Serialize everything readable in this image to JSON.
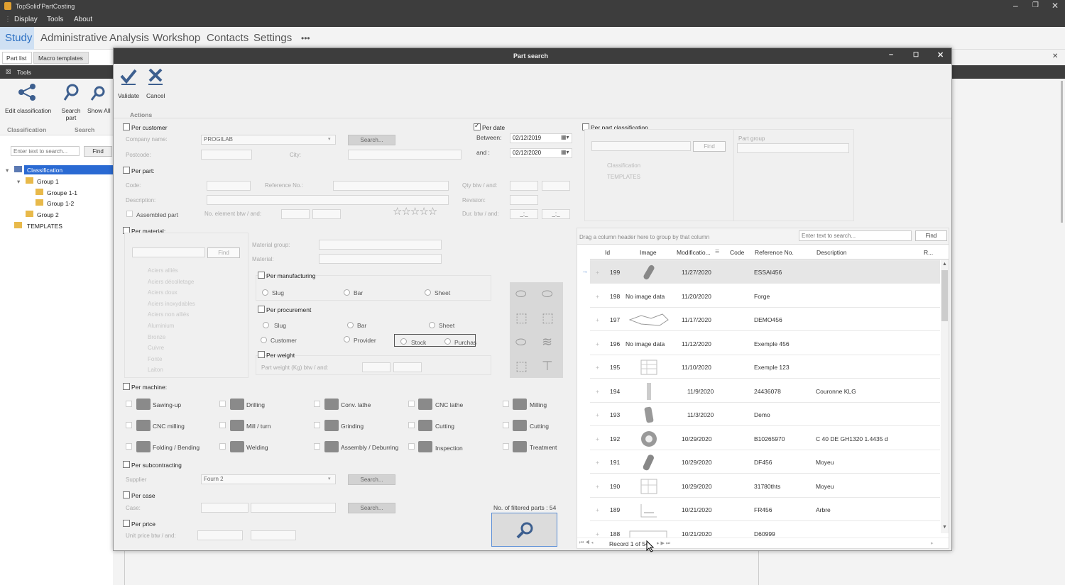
{
  "app": {
    "title": "TopSolid'PartCosting",
    "menu": [
      "Display",
      "Tools",
      "About"
    ]
  },
  "ribbon_tabs": [
    "Study",
    "Administrative",
    "Analysis",
    "Workshop",
    "Contacts",
    "Settings",
    "•••"
  ],
  "doc_tabs": [
    "Part list",
    "Macro templates"
  ],
  "tools_menu": "Tools",
  "left_ribbon": {
    "edit_classification": "Edit classification",
    "search_part": "Search part",
    "show_all": "Show All",
    "group_classification": "Classification",
    "group_search": "Search"
  },
  "left_search": {
    "placeholder": "Enter text to search...",
    "find": "Find"
  },
  "left_tree": [
    "Classification",
    "Group 1",
    "Groupe 1-1",
    "Group 1-2",
    "Group 2",
    "TEMPLATES"
  ],
  "dialog": {
    "title": "Part search",
    "validate": "Validate",
    "cancel": "Cancel",
    "actions": "Actions",
    "per_customer": "Per customer",
    "company_name": "Company name:",
    "company_value": "PROGILAB",
    "search_btn": "Search...",
    "postcode": "Postcode:",
    "city": "City:",
    "per_date": "Per date",
    "between": "Between:",
    "and": "and :",
    "date1": "02/12/2019",
    "date2": "02/12/2020",
    "per_part_classification": "Per part classification",
    "part_group": "Part group",
    "class_find": "Find",
    "class_tree": [
      "Classification",
      "TEMPLATES"
    ],
    "per_part": "Per part:",
    "code": "Code:",
    "reference": "Reference No.:",
    "qty": "Qty btw / and:",
    "description": "Description:",
    "revision": "Revision:",
    "assembled": "Assembled part",
    "no_element": "No. element btw / and:",
    "dur": "Dur. btw / and:",
    "dur1": "_:_",
    "dur2": "_:_",
    "per_material": "Per material:",
    "mat_find": "Find",
    "material_group": "Material group:",
    "material": "Material:",
    "material_list": [
      "Aciers alliés",
      "Aciers décolletage",
      "Aciers doux",
      "Aciers inoxydables",
      "Aciers non alliés",
      "Aluminium",
      "Bronze",
      "Cuivre",
      "Fonte",
      "Laiton"
    ],
    "per_manufacturing": "Per manufacturing",
    "manuf_opts": [
      "Slug",
      "Bar",
      "Sheet"
    ],
    "per_procurement": "Per procurement",
    "proc_opts": [
      "Slug",
      "Bar",
      "Sheet"
    ],
    "proc_opts2": [
      "Customer",
      "Provider"
    ],
    "stock": "Stock",
    "purchase": "Purchas",
    "per_weight": "Per weight",
    "part_weight": "Part weight (Kg) btw / and:",
    "per_machine": "Per machine:",
    "machines": [
      "Sawing-up",
      "Drilling",
      "Conv. lathe",
      "CNC lathe",
      "Milling",
      "CNC milling",
      "Mill / turn",
      "Grinding",
      "Cutting",
      "Cutting",
      "Folding / Bending",
      "Welding",
      "Assembly / Deburring",
      "Inspection",
      "Treatment"
    ],
    "per_subcontracting": "Per subcontracting",
    "supplier": "Supplier",
    "supplier_value": "Fourn 2",
    "per_case": "Per case",
    "case": "Case:",
    "per_price": "Per price",
    "unit_price": "Unit price btw / and:",
    "filtered": "No. of filtered parts : 54"
  },
  "grid": {
    "drag_hint": "Drag a column header here to group by that column",
    "search_placeholder": "Enter text to search...",
    "find": "Find",
    "columns": [
      "Id",
      "Image",
      "Modificatio...",
      "Code",
      "Reference No.",
      "Description",
      "R..."
    ],
    "rows": [
      {
        "id": "199",
        "image": "",
        "date": "11/27/2020",
        "ref": "ESSAI456",
        "desc": ""
      },
      {
        "id": "198",
        "image": "No image data",
        "date": "11/20/2020",
        "ref": "Forge",
        "desc": ""
      },
      {
        "id": "197",
        "image": "",
        "date": "11/17/2020",
        "ref": "DEMO456",
        "desc": ""
      },
      {
        "id": "196",
        "image": "No image data",
        "date": "11/12/2020",
        "ref": "Exemple 456",
        "desc": ""
      },
      {
        "id": "195",
        "image": "",
        "date": "11/10/2020",
        "ref": "Exemple 123",
        "desc": ""
      },
      {
        "id": "194",
        "image": "",
        "date": "11/9/2020",
        "ref": "24436078",
        "desc": "Couronne KLG"
      },
      {
        "id": "193",
        "image": "",
        "date": "11/3/2020",
        "ref": "Demo",
        "desc": ""
      },
      {
        "id": "192",
        "image": "",
        "date": "10/29/2020",
        "ref": "B10265970",
        "desc": "C 40 DE GH1320 1.4435 d"
      },
      {
        "id": "191",
        "image": "",
        "date": "10/29/2020",
        "ref": "DF456",
        "desc": "Moyeu"
      },
      {
        "id": "190",
        "image": "",
        "date": "10/29/2020",
        "ref": "31780thts",
        "desc": "Moyeu"
      },
      {
        "id": "189",
        "image": "",
        "date": "10/21/2020",
        "ref": "FR456",
        "desc": "Arbre"
      },
      {
        "id": "188",
        "image": "",
        "date": "10/21/2020",
        "ref": "D60999",
        "desc": ""
      }
    ],
    "record": "Record 1 of 54"
  }
}
